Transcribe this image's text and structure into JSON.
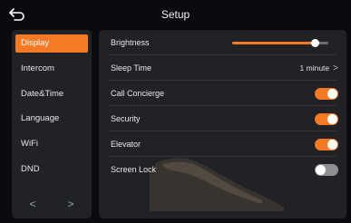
{
  "header": {
    "title": "Setup",
    "back_icon": "back-arrow-icon"
  },
  "sidebar": {
    "items": [
      {
        "label": "Display",
        "active": true
      },
      {
        "label": "Intercom",
        "active": false
      },
      {
        "label": "Date&Time",
        "active": false
      },
      {
        "label": "Language",
        "active": false
      },
      {
        "label": "WiFi",
        "active": false
      },
      {
        "label": "DND",
        "active": false
      }
    ],
    "prev_label": "<",
    "next_label": ">"
  },
  "settings": {
    "brightness": {
      "label": "Brightness",
      "level": 0.86
    },
    "sleep_time": {
      "label": "Sleep Time",
      "value": "1 minute",
      "chevron": ">"
    },
    "call_concierge": {
      "label": "Call Concierge",
      "on": true
    },
    "security": {
      "label": "Security",
      "on": true
    },
    "elevator": {
      "label": "Elevator",
      "on": true
    },
    "screen_lock": {
      "label": "Screen Lock",
      "on": false
    }
  },
  "colors": {
    "accent": "#f47a26",
    "panel": "#202226",
    "background": "#0a0b0e",
    "toggle_off": "#8e9095"
  }
}
